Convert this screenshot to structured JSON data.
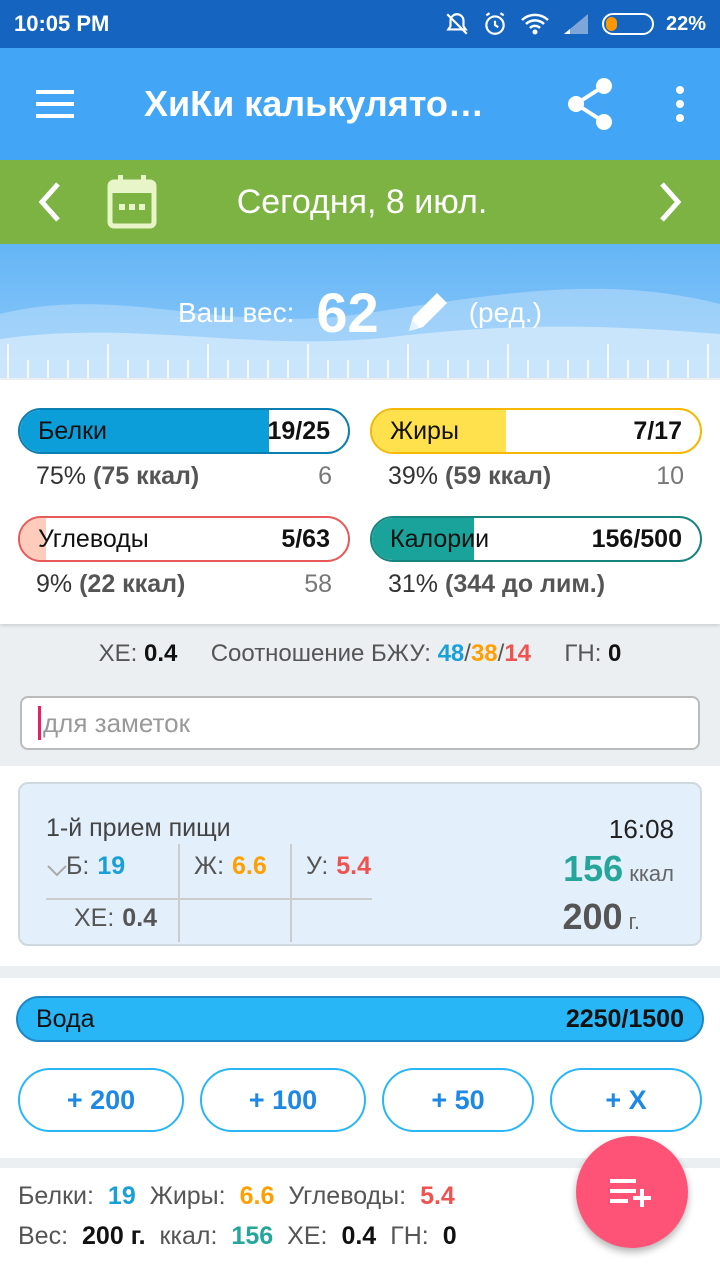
{
  "status_bar": {
    "time": "10:05 PM",
    "battery": "22%",
    "battery_level": 0.22
  },
  "app_bar": {
    "title": "ХиКи калькулято…"
  },
  "date_bar": {
    "date": "Сегодня, 8 июл."
  },
  "weight": {
    "label": "Ваш вес:",
    "value": "62",
    "edit": "(ред.)"
  },
  "macros": [
    {
      "name": "Белки",
      "value": "19/25",
      "fraction": 0.76,
      "color": "#0b9ed9",
      "border": "#0b7fb0",
      "percent": "75%",
      "kcal": "(75 ккал)",
      "remaining": "6"
    },
    {
      "name": "Жиры",
      "value": "7/17",
      "fraction": 0.41,
      "color": "#ffe14d",
      "border": "#f5b700",
      "percent": "39%",
      "kcal": "(59 ккал)",
      "remaining": "10"
    },
    {
      "name": "Углеводы",
      "value": "5/63",
      "fraction": 0.08,
      "color": "#ffccbc",
      "border": "#e85a5a",
      "percent": "9%",
      "kcal": "(22 ккал)",
      "remaining": "58"
    },
    {
      "name": "Калории",
      "value": "156/500",
      "fraction": 0.31,
      "color": "#1aa39a",
      "border": "#16857d",
      "percent": "31%",
      "kcal": "(344 до лим.)",
      "remaining": ""
    }
  ],
  "summary": {
    "xe_label": "ХЕ:",
    "xe": "0.4",
    "ratio_label": "Соотношение БЖУ:",
    "ratio_b": "48",
    "ratio_zh": "38",
    "ratio_u": "14",
    "gn_label": "ГН:",
    "gn": "0"
  },
  "notes": {
    "placeholder": "для заметок"
  },
  "meal": {
    "name": "1-й прием пищи",
    "time": "16:08",
    "b_label": "Б:",
    "b": "19",
    "zh_label": "Ж:",
    "zh": "6.6",
    "u_label": "У:",
    "u": "5.4",
    "xe_label": "ХЕ:",
    "xe": "0.4",
    "kcal": "156",
    "kcal_unit": "ккал",
    "grams": "200",
    "grams_unit": "г."
  },
  "water": {
    "name": "Вода",
    "value": "2250/1500",
    "buttons": [
      "+ 200",
      "+ 100",
      "+ 50",
      "+ X"
    ]
  },
  "totals": {
    "b_label": "Белки:",
    "b": "19",
    "zh_label": "Жиры:",
    "zh": "6.6",
    "u_label": "Углеводы:",
    "u": "5.4",
    "w_label": "Вес:",
    "w": "200 г.",
    "kcal_label": "ккал:",
    "kcal": "156",
    "xe_label": "ХЕ:",
    "xe": "0.4",
    "gn_label": "ГН:",
    "gn": "0"
  },
  "colors": {
    "protein": "#1aa0d8",
    "fat": "#ff9f00",
    "carb": "#ef5350",
    "kcal": "#26a69a",
    "fab": "#ff5277"
  }
}
